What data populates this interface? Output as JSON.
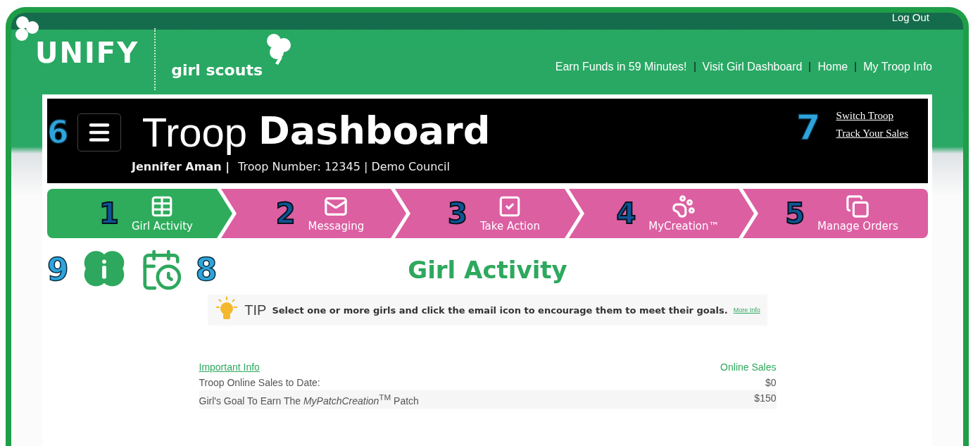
{
  "header": {
    "logout": "Log Out",
    "logo": "UNIFY",
    "brand": "girl scouts",
    "links": [
      "Earn Funds in 59 Minutes!",
      "Visit Girl Dashboard",
      "Home",
      "My Troop Info"
    ]
  },
  "dashboard": {
    "callout": "6",
    "title_light": "Troop",
    "title_bold": "Dashboard",
    "user": "Jennifer Aman |",
    "details": "Troop Number: 12345 | Demo Council",
    "links_callout": "7",
    "links": [
      "Switch Troop",
      "Track Your Sales"
    ]
  },
  "steps": [
    {
      "callout": "1",
      "label": "Girl Activity",
      "selected": true
    },
    {
      "callout": "2",
      "label": "Messaging",
      "selected": false
    },
    {
      "callout": "3",
      "label": "Take Action",
      "selected": false
    },
    {
      "callout": "4",
      "label": "MyCreation™",
      "selected": false
    },
    {
      "callout": "5",
      "label": "Manage Orders",
      "selected": false
    }
  ],
  "tools": {
    "left_callout": "9",
    "right_callout": "8"
  },
  "page_title": "Girl Activity",
  "tip": {
    "label": "TIP",
    "text": "Select one or more girls and click the email icon to encourage them to meet their goals.",
    "link": "More Info"
  },
  "info_table": {
    "heading": "Important Info",
    "column_2": "Online Sales",
    "rows": [
      {
        "label": "Troop Online Sales to Date:",
        "value": "$0"
      },
      {
        "label": "Girl's Goal To Earn The *MyPatchCreation*$^{TM}$ Patch",
        "value": "$150"
      }
    ]
  }
}
